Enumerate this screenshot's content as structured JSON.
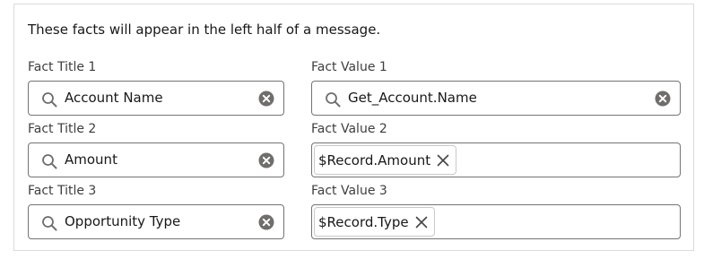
{
  "description": "These facts will appear in the left half of a message.",
  "facts": [
    {
      "title_label": "Fact Title 1",
      "title_value": "Account Name",
      "value_label": "Fact Value 1",
      "value_kind": "search",
      "value_text": "Get_Account.Name"
    },
    {
      "title_label": "Fact Title 2",
      "title_value": "Amount",
      "value_label": "Fact Value 2",
      "value_kind": "pill",
      "value_text": "$Record.Amount"
    },
    {
      "title_label": "Fact Title 3",
      "title_value": "Opportunity Type",
      "value_label": "Fact Value 3",
      "value_kind": "pill",
      "value_text": "$Record.Type"
    }
  ],
  "icons": {
    "search": "search-icon",
    "clear": "clear-icon",
    "remove": "remove-pill-icon"
  },
  "colors": {
    "border": "#747474",
    "panel_border": "#dddbda",
    "clear_icon": "#706e6b",
    "text": "#181818"
  }
}
